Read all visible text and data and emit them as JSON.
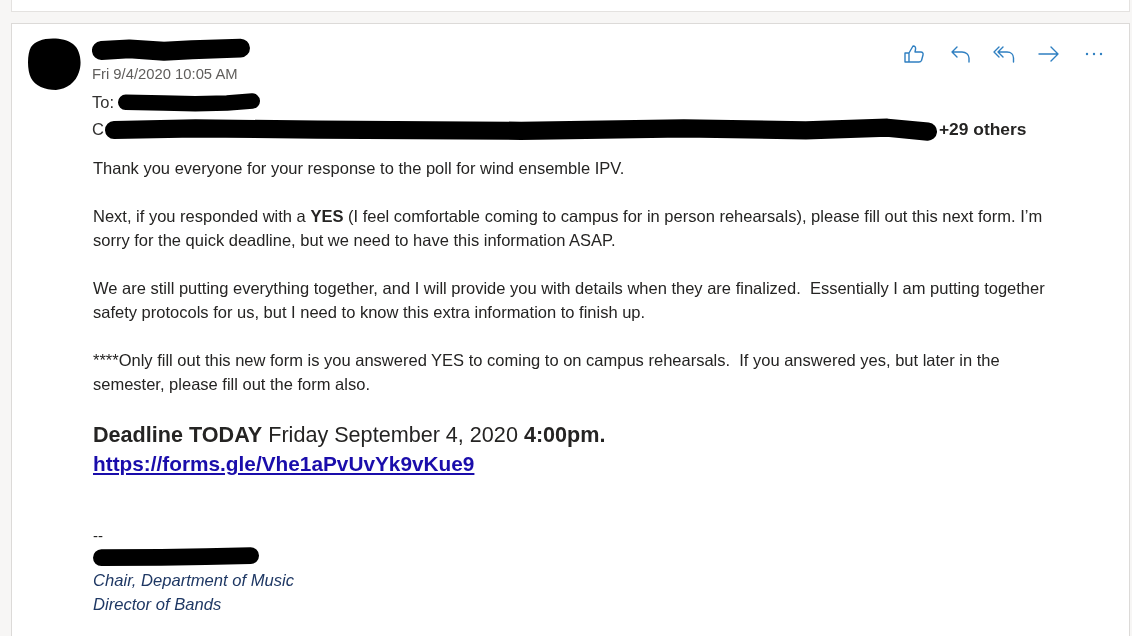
{
  "message": {
    "date": "Fri 9/4/2020 10:05 AM",
    "to_label": "To:",
    "cc_label": "C",
    "others": "+29 others"
  },
  "body": {
    "paragraphs": [
      "Thank you everyone for your response to the poll for wind ensemble IPV.",
      "Next, if you responded with a **YES** (I feel comfortable coming to campus for in person rehearsals), please fill out this next form. I’m sorry for the quick deadline, but we need to have this information ASAP.",
      "We are still putting everything together, and I will provide you with details when they are finalized.  Essentially I am putting together safety protocols for us, but I need to know this extra information to finish up.",
      "****Only fill out this new form is you answered YES to coming to on campus rehearsals.  If you answered yes, but later in the semester, please fill out the form also."
    ],
    "deadline": "**Deadline TODAY** Friday September 4, 2020 **4:00pm.**",
    "link": "https://forms.gle/Vhe1aPvUvYk9vKue9"
  },
  "signature": {
    "separator": "--",
    "lines": [
      "Chair, Department of Music",
      "Director of Bands"
    ]
  }
}
